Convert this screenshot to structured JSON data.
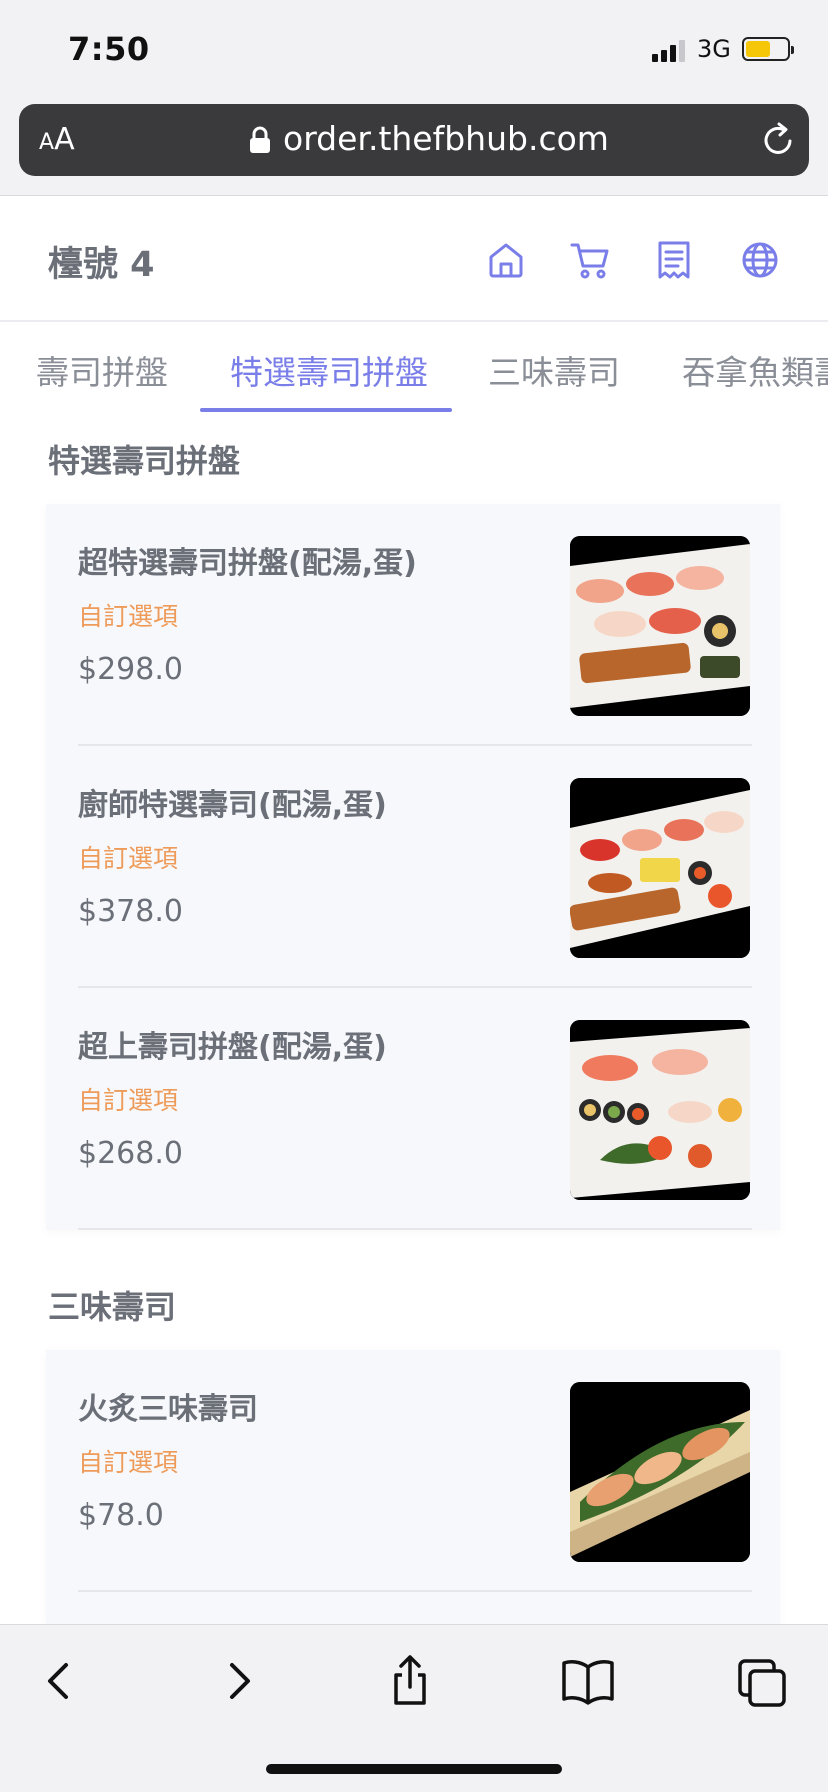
{
  "status_bar": {
    "time": "7:50",
    "network": "3G"
  },
  "browser": {
    "text_size_label": "AA",
    "url": "order.thefbhub.com"
  },
  "header": {
    "table_label": "檯號 4"
  },
  "header_icons": [
    "home-icon",
    "cart-icon",
    "receipt-icon",
    "globe-icon"
  ],
  "tabs": [
    {
      "label": "壽司拼盤",
      "active": false
    },
    {
      "label": "特選壽司拼盤",
      "active": true
    },
    {
      "label": "三味壽司",
      "active": false
    },
    {
      "label": "吞拿魚類壽司",
      "active": false
    }
  ],
  "sections": [
    {
      "title": "特選壽司拼盤",
      "items": [
        {
          "name": "超特選壽司拼盤(配湯,蛋)",
          "option": "自訂選項",
          "price": "$298.0"
        },
        {
          "name": "廚師特選壽司(配湯,蛋)",
          "option": "自訂選項",
          "price": "$378.0"
        },
        {
          "name": "超上壽司拼盤(配湯,蛋)",
          "option": "自訂選項",
          "price": "$268.0"
        }
      ]
    },
    {
      "title": "三味壽司",
      "items": [
        {
          "name": "火炙三味壽司",
          "option": "自訂選項",
          "price": "$78.0"
        }
      ]
    }
  ],
  "colors": {
    "accent": "#7a7ee8",
    "option_text": "#ee9b5a",
    "card_bg": "#f7f8fb"
  },
  "toolbar_icons": [
    "back-icon",
    "forward-icon",
    "share-icon",
    "bookmarks-icon",
    "tabs-icon"
  ]
}
